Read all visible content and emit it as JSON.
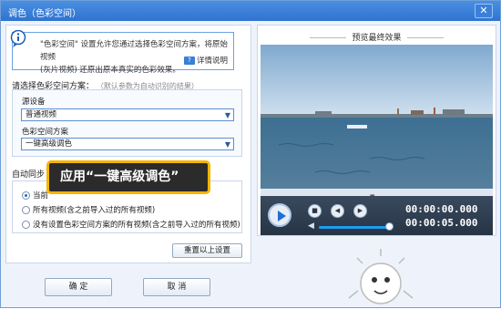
{
  "window": {
    "title": "调色（色彩空间）",
    "close_label": "✕"
  },
  "info": {
    "line1": "\"色彩空间\" 设置允许您通过选择色彩空间方案，将原始视频",
    "line2": "(灰片视频) 还原出原本真实的色彩效果。",
    "help_icon_text": "?",
    "help_label": "详情说明"
  },
  "scheme": {
    "heading": "请选择色彩空间方案：",
    "hint": "（默认参数为自动识别的结果）",
    "source_label": "源设备",
    "source_value": "普通视频",
    "colorspace_label": "色彩空间方案",
    "colorspace_value": "一键高级调色"
  },
  "sync": {
    "heading": "自动同步",
    "options": [
      "当前",
      "所有视频(含之前导入过的所有视频)",
      "没有设置色彩空间方案的所有视频(含之前导入过的所有视频)"
    ],
    "selected_index": 0,
    "reset_label": "重置以上设置"
  },
  "callout": {
    "text": "应用“一键高级调色”"
  },
  "buttons": {
    "ok": "确  定",
    "cancel": "取  消"
  },
  "preview": {
    "title": "预览最终效果",
    "current_time": "00:00:00.000",
    "total_time": "00:00:05.000"
  },
  "colors": {
    "accent": "#2f73cf",
    "callout_border": "#f5b400",
    "callout_bg": "#2b2b2b"
  },
  "icons": [
    "info-icon",
    "help-icon",
    "close-icon",
    "play-icon",
    "stop-icon",
    "prev-icon",
    "next-icon",
    "volume-icon",
    "dropdown-arrow-icon"
  ]
}
